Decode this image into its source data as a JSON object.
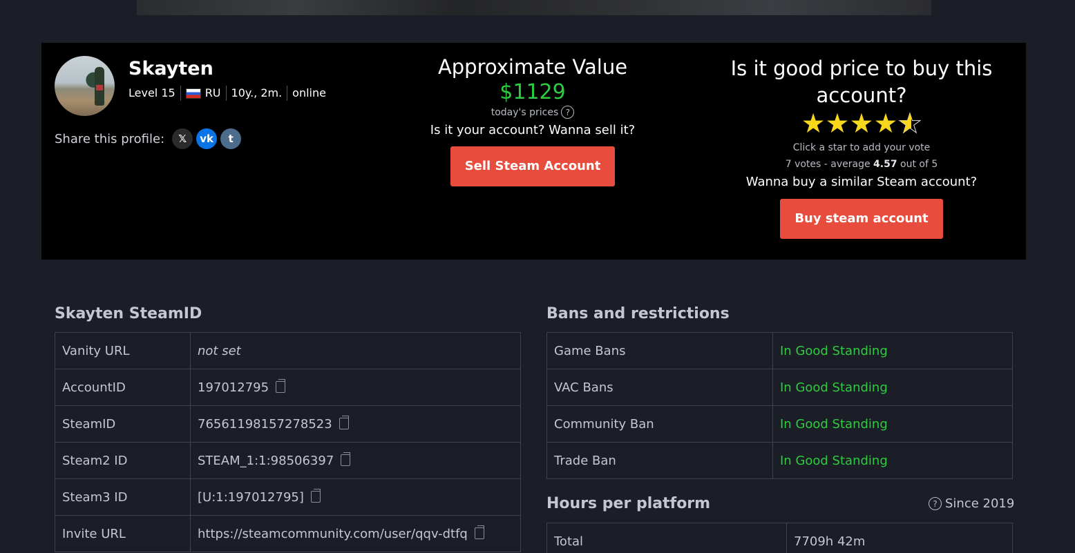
{
  "profile": {
    "username": "Skayten",
    "level": "Level 15",
    "country": "RU",
    "account_age": "10y., 2m.",
    "status": "online",
    "share_label": "Share this profile:",
    "social": [
      {
        "label": "𝕏",
        "name": "x-share-icon"
      },
      {
        "label": "vk",
        "name": "vk-share-icon"
      },
      {
        "label": "t",
        "name": "tumblr-share-icon"
      }
    ]
  },
  "valuation": {
    "title": "Approximate Value",
    "amount": "$1129",
    "prices_note": "today's prices",
    "sell_question": "Is it your account? Wanna sell it?",
    "sell_button": "Sell Steam Account"
  },
  "rating": {
    "title": "Is it good price to buy this account?",
    "stars": 4.57,
    "hint": "Click a star to add your vote",
    "votes_prefix": "7 votes - average",
    "average": "4.57",
    "votes_suffix": "out of 5",
    "buy_question": "Wanna buy a similar Steam account?",
    "buy_button": "Buy steam account"
  },
  "steamid": {
    "title": "Skayten SteamID",
    "rows": [
      {
        "label": "Vanity URL",
        "value": "not set",
        "copy": false
      },
      {
        "label": "AccountID",
        "value": "197012795",
        "copy": true
      },
      {
        "label": "SteamID",
        "value": "76561198157278523",
        "copy": true
      },
      {
        "label": "Steam2 ID",
        "value": "STEAM_1:1:98506397",
        "copy": true
      },
      {
        "label": "Steam3 ID",
        "value": "[U:1:197012795]",
        "copy": true
      },
      {
        "label": "Invite URL",
        "value": "https://steamcommunity.com/user/qqv-dtfq",
        "copy": true
      }
    ]
  },
  "bans": {
    "title": "Bans and restrictions",
    "rows": [
      {
        "label": "Game Bans",
        "value": "In Good Standing"
      },
      {
        "label": "VAC Bans",
        "value": "In Good Standing"
      },
      {
        "label": "Community Ban",
        "value": "In Good Standing"
      },
      {
        "label": "Trade Ban",
        "value": "In Good Standing"
      }
    ]
  },
  "hours": {
    "title": "Hours per platform",
    "since": "Since 2019",
    "rows": [
      {
        "label": "Total",
        "value": "7709h 42m"
      }
    ]
  },
  "colors": {
    "accent_red": "#e74c3c",
    "good_green": "#2ecc40",
    "star_yellow": "#f9d71c"
  }
}
